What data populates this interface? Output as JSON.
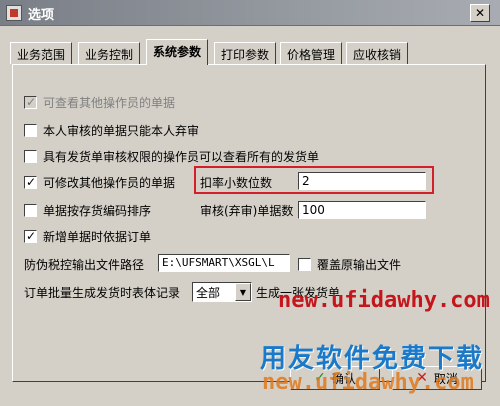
{
  "window": {
    "title": "选项",
    "close_glyph": "✕"
  },
  "tabs": [
    {
      "label": "业务范围",
      "active": false
    },
    {
      "label": "业务控制",
      "active": false
    },
    {
      "label": "系统参数",
      "active": true
    },
    {
      "label": "打印参数",
      "active": false
    },
    {
      "label": "价格管理",
      "active": false
    },
    {
      "label": "应收核销",
      "active": false
    }
  ],
  "options": {
    "view_others": {
      "label": "可查看其他操作员的单据",
      "checked": true,
      "disabled": true
    },
    "self_abandon": {
      "label": "本人审核的单据只能本人弃审",
      "checked": false
    },
    "view_all_delivery": {
      "label": "具有发货单审核权限的操作员可以查看所有的发货单",
      "checked": false
    },
    "modify_others": {
      "label": "可修改其他操作员的单据",
      "checked": true
    },
    "sort_by_inventory": {
      "label": "单据按存货编码排序",
      "checked": false
    },
    "new_by_order": {
      "label": "新增单据时依据订单",
      "checked": true
    },
    "overwrite_output": {
      "label": "覆盖原输出文件",
      "checked": false
    }
  },
  "discount_decimals": {
    "label": "扣率小数位数",
    "value": "2"
  },
  "audit_count": {
    "label": "审核(弃审)单据数",
    "value": "100"
  },
  "tax_output": {
    "label": "防伪税控输出文件路径",
    "value": "E:\\UFSMART\\XSGL\\L"
  },
  "batch_order": {
    "label": "订单批量生成发货时表体记录",
    "selected": "全部",
    "suffix": "生成一张发货单"
  },
  "buttons": {
    "ok_label": "确认",
    "cancel_label": "取消"
  },
  "overlay": {
    "watermark": "new.ufidawhy.com",
    "promo": "用友软件免费下载",
    "watermark_lower": "new.ufidawhy.com"
  }
}
